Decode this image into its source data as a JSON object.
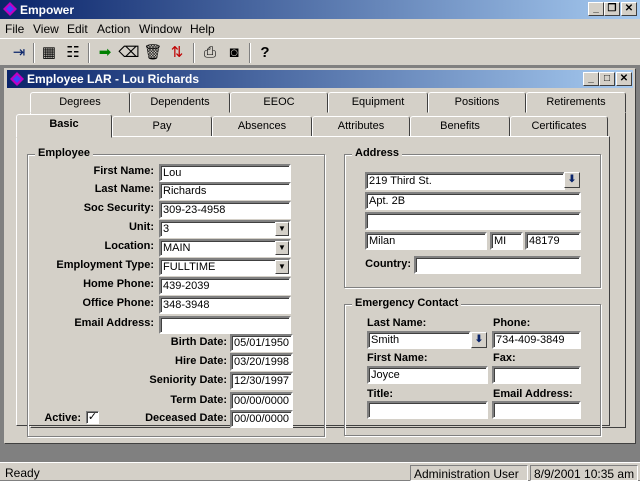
{
  "app": {
    "title": "Empower"
  },
  "menu": [
    "File",
    "View",
    "Edit",
    "Action",
    "Window",
    "Help"
  ],
  "child": {
    "title": "Employee LAR - Lou Richards"
  },
  "tabs_back": [
    "Degrees",
    "Dependents",
    "EEOC",
    "Equipment",
    "Positions",
    "Retirements"
  ],
  "tabs_front": [
    "Basic",
    "Pay",
    "Absences",
    "Attributes",
    "Benefits",
    "Certificates"
  ],
  "employee": {
    "group_label": "Employee",
    "first_name_label": "First Name:",
    "first_name": "Lou",
    "last_name_label": "Last Name:",
    "last_name": "Richards",
    "ssn_label": "Soc Security:",
    "ssn": "309-23-4958",
    "unit_label": "Unit:",
    "unit": "3",
    "location_label": "Location:",
    "location": "MAIN",
    "employment_type_label": "Employment Type:",
    "employment_type": "FULLTIME",
    "home_phone_label": "Home Phone:",
    "home_phone": "439-2039",
    "office_phone_label": "Office Phone:",
    "office_phone": "348-3948",
    "email_label": "Email Address:",
    "email": "",
    "birth_date_label": "Birth Date:",
    "birth_date": "05/01/1950",
    "hire_date_label": "Hire Date:",
    "hire_date": "03/20/1998",
    "seniority_date_label": "Seniority Date:",
    "seniority_date": "12/30/1997",
    "term_date_label": "Term Date:",
    "term_date": "00/00/0000",
    "deceased_date_label": "Deceased Date:",
    "deceased_date": "00/00/0000",
    "active_label": "Active:",
    "active_check": "✓"
  },
  "address": {
    "group_label": "Address",
    "line1": "219 Third St.",
    "line2": "Apt. 2B",
    "line3": "",
    "city": "Milan",
    "state": "MI",
    "zip": "48179",
    "country_label": "Country:",
    "country": ""
  },
  "emergency": {
    "group_label": "Emergency Contact",
    "last_name_label": "Last Name:",
    "last_name": "Smith",
    "phone_label": "Phone:",
    "phone": "734-409-3849",
    "first_name_label": "First Name:",
    "first_name": "Joyce",
    "fax_label": "Fax:",
    "fax": "",
    "title_label": "Title:",
    "title": "",
    "email_label": "Email Address:",
    "email": ""
  },
  "status": {
    "text": "Ready",
    "user": "Administration User",
    "datetime": "8/9/2001 10:35 am"
  }
}
